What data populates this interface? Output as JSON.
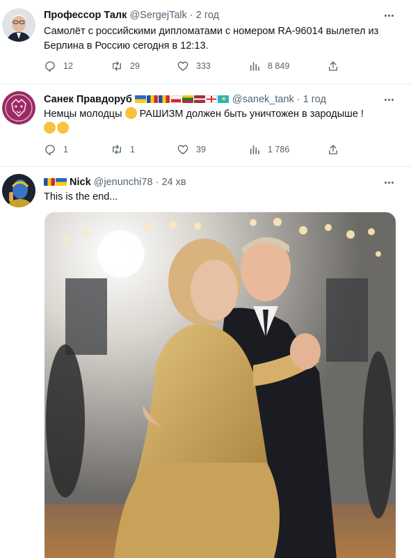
{
  "tweets": [
    {
      "name": "Профессор Талк",
      "handle": "@SergejTalk",
      "dot": "·",
      "time": "2 год",
      "text": "Самолёт с российскими дипломатами с номером RA-96014 вылетел из Берлина в Россию сегодня в 12:13.",
      "replies": "12",
      "retweets": "29",
      "likes": "333",
      "views": "8 849"
    },
    {
      "name": "Санек Правдоруб",
      "handle": "@sanek_tank",
      "dot": "·",
      "time": "1 год",
      "text_a": "Немцы молодцы ",
      "text_b": " РАШИЗМ должен быть уничтожен в зародыше !",
      "replies": "1",
      "retweets": "1",
      "likes": "39",
      "views": "1 786"
    },
    {
      "name": "Nick",
      "handle": "@jenunchi78",
      "dot": "·",
      "time": "24 хв",
      "text": "This is the end..."
    }
  ],
  "icons": [
    "reply-icon",
    "retweet-icon",
    "like-icon",
    "views-icon",
    "share-icon",
    "more-icon"
  ],
  "colors": {
    "text": "#0f1419",
    "muted": "#536471",
    "divider": "#e6ecf0"
  }
}
